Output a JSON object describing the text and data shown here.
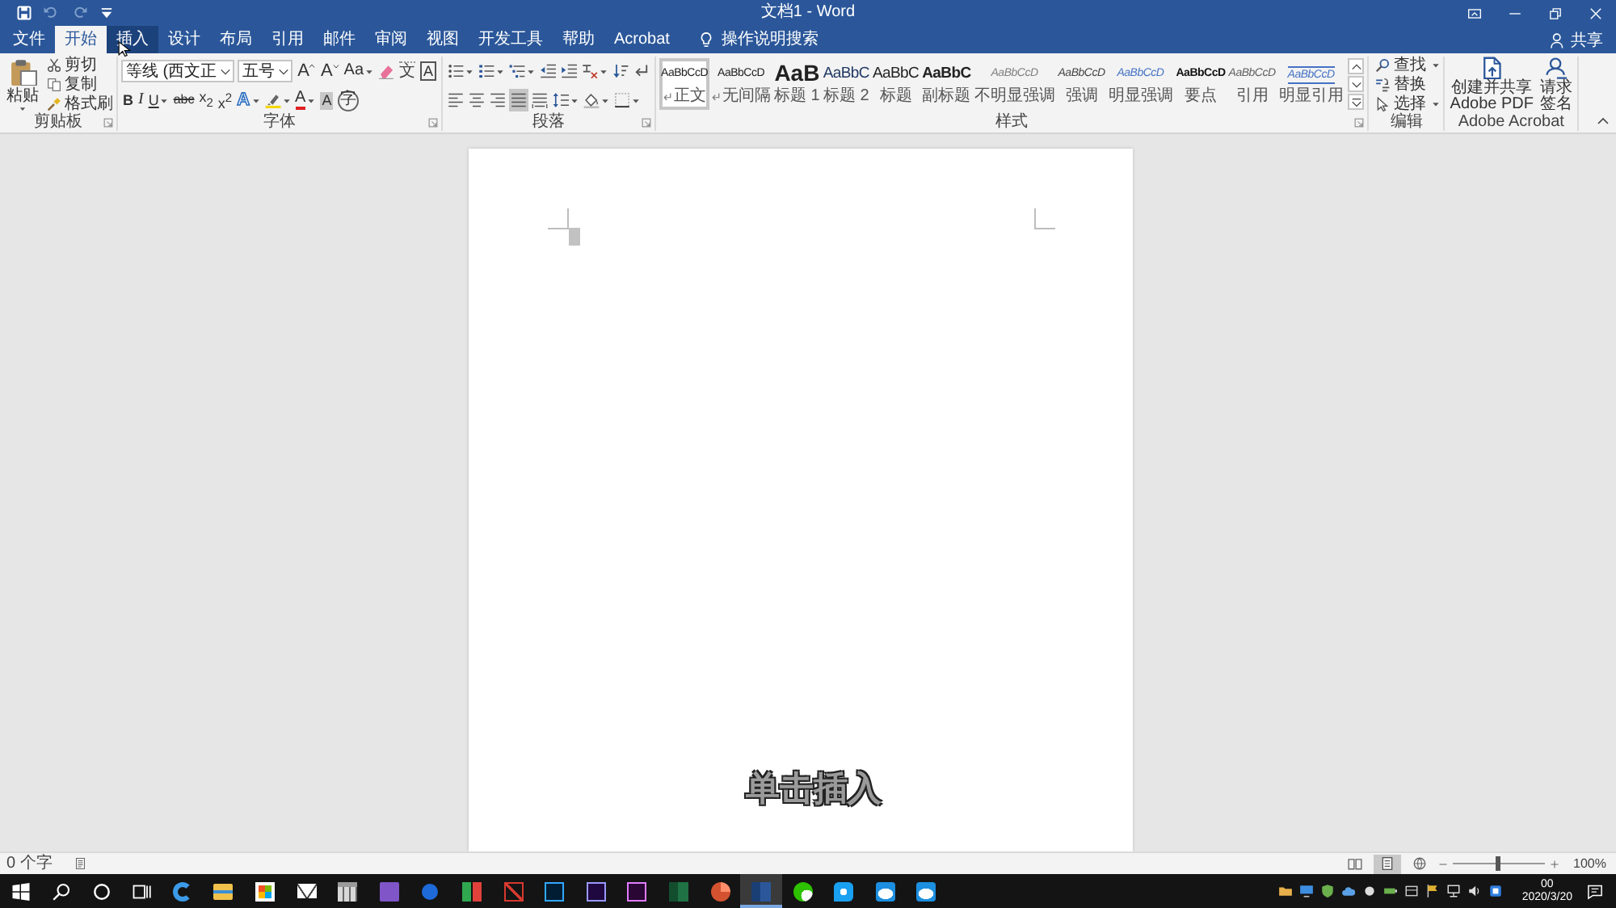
{
  "title_bar": {
    "title": "文档1 - Word",
    "quick_access": [
      {
        "kind": "save",
        "disabled": false
      },
      {
        "kind": "undo",
        "disabled": true
      },
      {
        "kind": "redo",
        "disabled": true
      },
      {
        "kind": "customize",
        "disabled": false
      }
    ]
  },
  "tabs": [
    {
      "label": "文件",
      "selected": false,
      "hovered": false
    },
    {
      "label": "开始",
      "selected": true,
      "hovered": false
    },
    {
      "label": "插入",
      "selected": false,
      "hovered": true
    },
    {
      "label": "设计",
      "selected": false,
      "hovered": false
    },
    {
      "label": "布局",
      "selected": false,
      "hovered": false
    },
    {
      "label": "引用",
      "selected": false,
      "hovered": false
    },
    {
      "label": "邮件",
      "selected": false,
      "hovered": false
    },
    {
      "label": "审阅",
      "selected": false,
      "hovered": false
    },
    {
      "label": "视图",
      "selected": false,
      "hovered": false
    },
    {
      "label": "开发工具",
      "selected": false,
      "hovered": false
    },
    {
      "label": "帮助",
      "selected": false,
      "hovered": false
    },
    {
      "label": "Acrobat",
      "selected": false,
      "hovered": false
    }
  ],
  "tell_me": {
    "placeholder": "操作说明搜索"
  },
  "share": {
    "label": "共享"
  },
  "ribbon": {
    "groups": [
      {
        "kind": "clipboard",
        "label": "剪贴板",
        "launcher": true,
        "paste": {
          "label": "粘贴"
        },
        "commands": [
          {
            "kind": "cut",
            "label": "剪切"
          },
          {
            "kind": "copy",
            "label": "复制"
          },
          {
            "kind": "format_painter",
            "label": "格式刷"
          }
        ]
      },
      {
        "kind": "font",
        "label": "字体",
        "launcher": true,
        "font_name": "等线 (西文正",
        "font_size": "五号",
        "row_1": [
          {
            "kind": "grow",
            "glyph": "A",
            "dropdown": false
          },
          {
            "kind": "shrink",
            "glyph": "A",
            "dropdown": false
          },
          {
            "kind": "change_case",
            "glyph": "Aa",
            "dropdown": true
          },
          {
            "kind": "clear_format",
            "dropdown": false
          },
          {
            "kind": "phonetic",
            "glyph": "文",
            "dropdown": false
          },
          {
            "kind": "char_border",
            "glyph": "A",
            "dropdown": false
          }
        ],
        "row_2": [
          {
            "kind": "bold",
            "glyph": "B",
            "dropdown": false
          },
          {
            "kind": "italic",
            "glyph": "I",
            "dropdown": false
          },
          {
            "kind": "underline",
            "glyph": "U",
            "dropdown": true
          },
          {
            "kind": "strike",
            "glyph": "abc",
            "dropdown": false
          },
          {
            "kind": "subscript",
            "glyph": "x$_{2}$",
            "dropdown": false
          },
          {
            "kind": "superscript",
            "glyph": "x$^{2}$",
            "dropdown": false
          },
          {
            "kind": "text_effects",
            "glyph": "A",
            "dropdown": true
          },
          {
            "kind": "highlight",
            "dropdown": true
          },
          {
            "kind": "font_color",
            "glyph": "A",
            "dropdown": true
          },
          {
            "kind": "char_shading",
            "glyph": "A",
            "dropdown": false
          },
          {
            "kind": "enclose",
            "glyph": "字",
            "dropdown": false
          }
        ]
      },
      {
        "kind": "paragraph",
        "label": "段落",
        "launcher": true,
        "row_1": [
          {
            "kind": "bullets",
            "dropdown": true,
            "selected": false
          },
          {
            "kind": "numbering",
            "dropdown": true,
            "selected": false
          },
          {
            "kind": "multilevel",
            "dropdown": true,
            "selected": false
          },
          {
            "kind": "decrease_indent",
            "dropdown": false,
            "selected": false
          },
          {
            "kind": "increase_indent",
            "dropdown": false,
            "selected": false
          },
          {
            "kind": "asian_layout",
            "dropdown": true,
            "selected": false
          },
          {
            "kind": "sort",
            "dropdown": false,
            "selected": false
          },
          {
            "kind": "show_marks",
            "dropdown": false,
            "selected": false
          }
        ],
        "row_2": [
          {
            "kind": "align_left",
            "dropdown": false,
            "selected": false
          },
          {
            "kind": "align_center",
            "dropdown": false,
            "selected": false
          },
          {
            "kind": "align_right",
            "dropdown": false,
            "selected": false
          },
          {
            "kind": "justify",
            "dropdown": false,
            "selected": true
          },
          {
            "kind": "distribute",
            "dropdown": false,
            "selected": false
          },
          {
            "kind": "line_spacing",
            "dropdown": true,
            "selected": false
          },
          {
            "kind": "shading",
            "dropdown": true,
            "selected": false
          },
          {
            "kind": "borders",
            "dropdown": true,
            "selected": false
          }
        ]
      },
      {
        "kind": "styles",
        "label": "样式",
        "launcher": true,
        "gallery": [
          {
            "kind": "normal",
            "sample": "AaBbCcD",
            "name": "正文",
            "mark": true,
            "selected": true
          },
          {
            "kind": "no_spacing",
            "sample": "AaBbCcD",
            "name": "无间隔",
            "mark": true,
            "selected": false
          },
          {
            "kind": "heading1",
            "sample": "AaB",
            "name": "标题 1",
            "mark": false,
            "selected": false
          },
          {
            "kind": "heading2",
            "sample": "AaBbC",
            "name": "标题 2",
            "mark": false,
            "selected": false
          },
          {
            "kind": "title",
            "sample": "AaBbC",
            "name": "标题",
            "mark": false,
            "selected": false
          },
          {
            "kind": "subtitle",
            "sample": "AaBbC",
            "name": "副标题",
            "mark": false,
            "selected": false
          },
          {
            "kind": "subtle_emphasis",
            "sample": "AaBbCcD",
            "name": "不明显强调",
            "mark": false,
            "selected": false
          },
          {
            "kind": "emphasis",
            "sample": "AaBbCcD",
            "name": "强调",
            "mark": false,
            "selected": false
          },
          {
            "kind": "intense_emphasis",
            "sample": "AaBbCcD",
            "name": "明显强调",
            "mark": false,
            "selected": false
          },
          {
            "kind": "strong",
            "sample": "AaBbCcD",
            "name": "要点",
            "mark": false,
            "selected": false
          },
          {
            "kind": "quote",
            "sample": "AaBbCcD",
            "name": "引用",
            "mark": false,
            "selected": false
          },
          {
            "kind": "intense_quote",
            "sample": "AaBbCcD",
            "name": "明显引用",
            "mark": false,
            "selected": false
          }
        ]
      },
      {
        "kind": "editing",
        "label": "编辑",
        "launcher": false,
        "commands": [
          {
            "kind": "find",
            "label": "查找",
            "dropdown": true
          },
          {
            "kind": "replace",
            "label": "替换",
            "dropdown": false
          },
          {
            "kind": "select",
            "label": "选择",
            "dropdown": true
          }
        ]
      },
      {
        "kind": "acrobat",
        "label": "Adobe Acrobat",
        "launcher": false,
        "buttons": [
          {
            "kind": "create_pdf",
            "lines": [
              "创建并共享",
              "Adobe PDF"
            ]
          },
          {
            "kind": "request_signature",
            "lines": [
              "请求",
              "签名"
            ]
          }
        ]
      }
    ]
  },
  "document": {
    "caption": "单击插入"
  },
  "status_bar": {
    "word_count": "0 个字",
    "views": [
      {
        "kind": "read",
        "selected": false
      },
      {
        "kind": "print",
        "selected": true
      },
      {
        "kind": "web",
        "selected": false
      }
    ],
    "zoom": {
      "level": 0.5,
      "reading": "100%"
    }
  },
  "taskbar": {
    "apps": [
      {
        "kind": "browser",
        "active": false
      },
      {
        "kind": "folder",
        "active": false
      },
      {
        "kind": "store",
        "active": false
      },
      {
        "kind": "mail",
        "active": false
      },
      {
        "kind": "calendar",
        "active": false
      },
      {
        "kind": "studio",
        "active": false
      },
      {
        "kind": "finance",
        "active": false
      },
      {
        "kind": "bookmark",
        "active": false
      },
      {
        "kind": "chart",
        "active": false
      },
      {
        "kind": "image_editor",
        "active": false
      },
      {
        "kind": "motion_editor",
        "active": false
      },
      {
        "kind": "video_editor",
        "active": false
      },
      {
        "kind": "spreadsheet",
        "active": false
      },
      {
        "kind": "presentation",
        "active": false
      },
      {
        "kind": "document",
        "active": true
      },
      {
        "kind": "chat",
        "active": false
      },
      {
        "kind": "messenger",
        "active": false
      },
      {
        "kind": "cloud",
        "active": false
      },
      {
        "kind": "cloud",
        "active": false
      }
    ],
    "clock": {
      "time": "00",
      "date": "2020/3/20"
    }
  }
}
